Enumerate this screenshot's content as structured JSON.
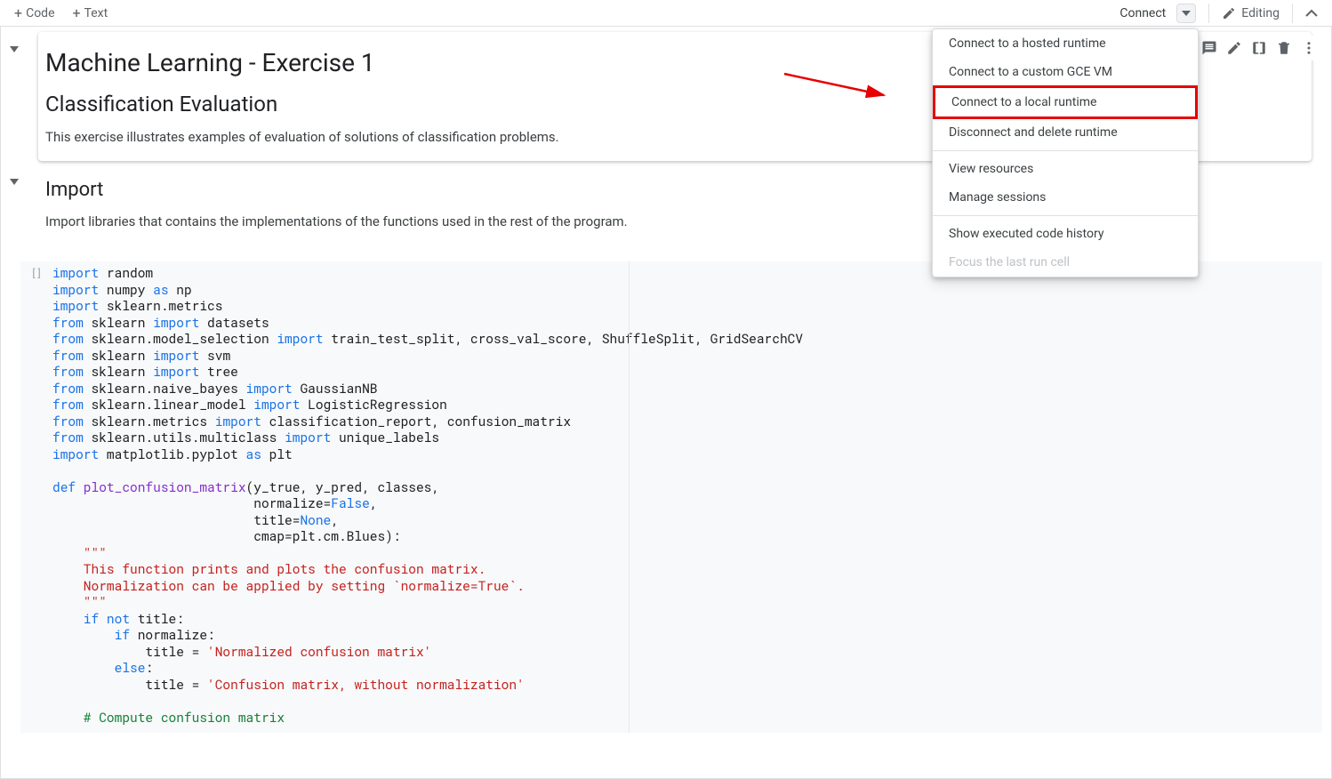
{
  "toolbar": {
    "code_label": "Code",
    "text_label": "Text",
    "connect_label": "Connect",
    "editing_label": "Editing"
  },
  "connect_menu": {
    "hosted": "Connect to a hosted runtime",
    "gce": "Connect to a custom GCE VM",
    "local": "Connect to a local runtime",
    "disconnect": "Disconnect and delete runtime",
    "resources": "View resources",
    "sessions": "Manage sessions",
    "history": "Show executed code history",
    "focus_last": "Focus the last run cell"
  },
  "cells": {
    "title_h1": "Machine Learning - Exercise 1",
    "title_h2": "Classification Evaluation",
    "title_p": "This exercise illustrates examples of evaluation of solutions of classification problems.",
    "import_h2": "Import",
    "import_p": "Import libraries that contains the implementations of the functions used in the rest of the program.",
    "code_cell_bracket": "[ ]"
  },
  "code": {
    "l01_kw": "import",
    "l01_id": " random",
    "l02_kw": "import",
    "l02_id": " numpy ",
    "l02_as": "as",
    "l02_np": " np",
    "l03_kw": "import",
    "l03_id": " sklearn.metrics",
    "l04_from": "from",
    "l04_mod": " sklearn ",
    "l04_imp": "import",
    "l04_what": " datasets",
    "l05_from": "from",
    "l05_mod": " sklearn.model_selection ",
    "l05_imp": "import",
    "l05_what": " train_test_split, cross_val_score, ShuffleSplit, GridSearchCV",
    "l06_from": "from",
    "l06_mod": " sklearn ",
    "l06_imp": "import",
    "l06_what": " svm",
    "l07_from": "from",
    "l07_mod": " sklearn ",
    "l07_imp": "import",
    "l07_what": " tree",
    "l08_from": "from",
    "l08_mod": " sklearn.naive_bayes ",
    "l08_imp": "import",
    "l08_what": " GaussianNB",
    "l09_from": "from",
    "l09_mod": " sklearn.linear_model ",
    "l09_imp": "import",
    "l09_what": " LogisticRegression",
    "l10_from": "from",
    "l10_mod": " sklearn.metrics ",
    "l10_imp": "import",
    "l10_what": " classification_report, confusion_matrix",
    "l11_from": "from",
    "l11_mod": " sklearn.utils.multiclass ",
    "l11_imp": "import",
    "l11_what": " unique_labels",
    "l12_kw": "import",
    "l12_id": " matplotlib.pyplot ",
    "l12_as": "as",
    "l12_plt": " plt",
    "l14_def": "def",
    "l14_fn": " plot_confusion_matrix",
    "l14_sig": "(y_true, y_pred, classes,",
    "l15_sig": "                          normalize=",
    "l15_false": "False",
    "l15_comma": ",",
    "l16_sig": "                          title=",
    "l16_none": "None",
    "l16_comma": ",",
    "l17_sig": "                          cmap=plt.cm.Blues):",
    "l18_tq": "    \"\"\"",
    "l19_doc": "    This function prints and plots the confusion matrix.",
    "l20_doc": "    Normalization can be applied by setting `normalize=True`.",
    "l21_tq": "    \"\"\"",
    "l22_if": "    if",
    "l22_not": " not",
    "l22_rest": " title:",
    "l23_if": "        if",
    "l23_rest": " normalize:",
    "l24_assign_pre": "            title = ",
    "l24_str": "'Normalized confusion matrix'",
    "l25_else": "        else",
    "l25_colon": ":",
    "l26_assign_pre": "            title = ",
    "l26_str": "'Confusion matrix, without normalization'",
    "l28_cmt": "    # Compute confusion matrix"
  }
}
